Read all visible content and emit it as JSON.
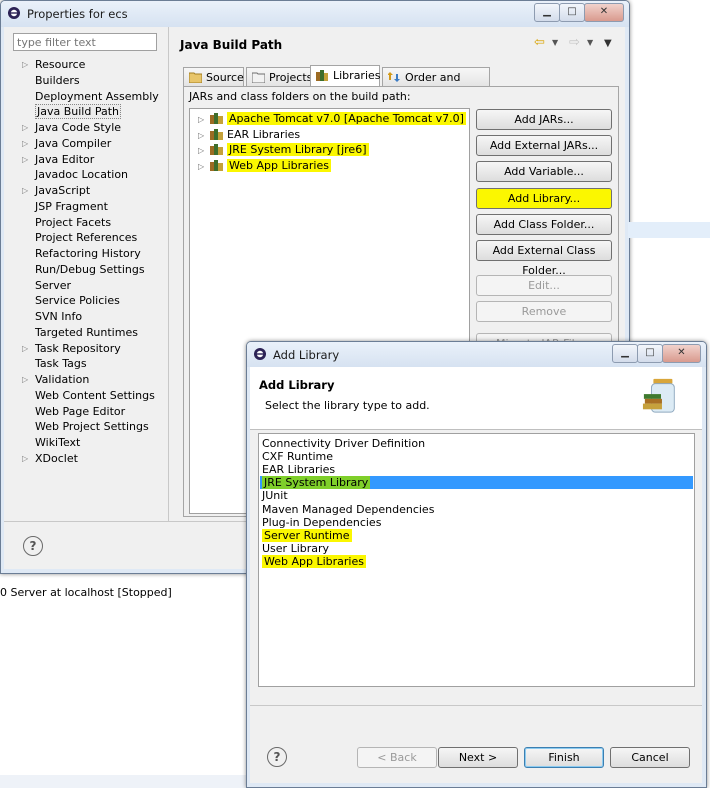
{
  "props": {
    "title": "Properties for ecs",
    "filter_placeholder": "type filter text",
    "nav": [
      {
        "label": "Resource",
        "arrow": true
      },
      {
        "label": "Builders",
        "arrow": false
      },
      {
        "label": "Deployment Assembly",
        "arrow": false
      },
      {
        "label": "Java Build Path",
        "arrow": false,
        "selected": true
      },
      {
        "label": "Java Code Style",
        "arrow": true
      },
      {
        "label": "Java Compiler",
        "arrow": true
      },
      {
        "label": "Java Editor",
        "arrow": true
      },
      {
        "label": "Javadoc Location",
        "arrow": false
      },
      {
        "label": "JavaScript",
        "arrow": true
      },
      {
        "label": "JSP Fragment",
        "arrow": false
      },
      {
        "label": "Project Facets",
        "arrow": false
      },
      {
        "label": "Project References",
        "arrow": false
      },
      {
        "label": "Refactoring History",
        "arrow": false
      },
      {
        "label": "Run/Debug Settings",
        "arrow": false
      },
      {
        "label": "Server",
        "arrow": false
      },
      {
        "label": "Service Policies",
        "arrow": false
      },
      {
        "label": "SVN Info",
        "arrow": false
      },
      {
        "label": "Targeted Runtimes",
        "arrow": false
      },
      {
        "label": "Task Repository",
        "arrow": true
      },
      {
        "label": "Task Tags",
        "arrow": false
      },
      {
        "label": "Validation",
        "arrow": true
      },
      {
        "label": "Web Content Settings",
        "arrow": false
      },
      {
        "label": "Web Page Editor",
        "arrow": false
      },
      {
        "label": "Web Project Settings",
        "arrow": false
      },
      {
        "label": "WikiText",
        "arrow": false
      },
      {
        "label": "XDoclet",
        "arrow": true
      }
    ],
    "page_title": "Java Build Path",
    "tabs": [
      "Source",
      "Projects",
      "Libraries",
      "Order and Export"
    ],
    "jars_label": "JARs and class folders on the build path:",
    "libs": [
      {
        "label": "Apache Tomcat v7.0 [Apache Tomcat v7.0]",
        "highlight": true
      },
      {
        "label": "EAR Libraries",
        "highlight": false
      },
      {
        "label": "JRE System Library [jre6]",
        "highlight": true
      },
      {
        "label": "Web App Libraries",
        "highlight": true
      }
    ],
    "buttons": {
      "add_jars": "Add JARs...",
      "add_external_jars": "Add External JARs...",
      "add_variable": "Add Variable...",
      "add_library": "Add Library...",
      "add_class_folder": "Add Class Folder...",
      "add_external_class_folder": "Add External Class Folder...",
      "edit": "Edit...",
      "remove": "Remove",
      "migrate": "Migrate JAR File..."
    }
  },
  "background": {
    "server_status": "0 Server at localhost  [Stopped]"
  },
  "add_library": {
    "title": "Add Library",
    "heading": "Add Library",
    "description": "Select the library type to add.",
    "items": [
      {
        "label": "Connectivity Driver Definition",
        "highlight": false
      },
      {
        "label": "CXF Runtime",
        "highlight": false
      },
      {
        "label": "EAR Libraries",
        "highlight": false
      },
      {
        "label": "JRE System Library",
        "highlight": true,
        "selected": true
      },
      {
        "label": "JUnit",
        "highlight": false
      },
      {
        "label": "Maven Managed Dependencies",
        "highlight": false
      },
      {
        "label": "Plug-in Dependencies",
        "highlight": false
      },
      {
        "label": "Server Runtime",
        "highlight": true
      },
      {
        "label": "User Library",
        "highlight": false
      },
      {
        "label": "Web App Libraries",
        "highlight": true
      }
    ],
    "buttons": {
      "back": "< Back",
      "next": "Next >",
      "finish": "Finish",
      "cancel": "Cancel"
    }
  },
  "colors": {
    "highlight": "#fbf700",
    "selection": "#3399ff"
  }
}
